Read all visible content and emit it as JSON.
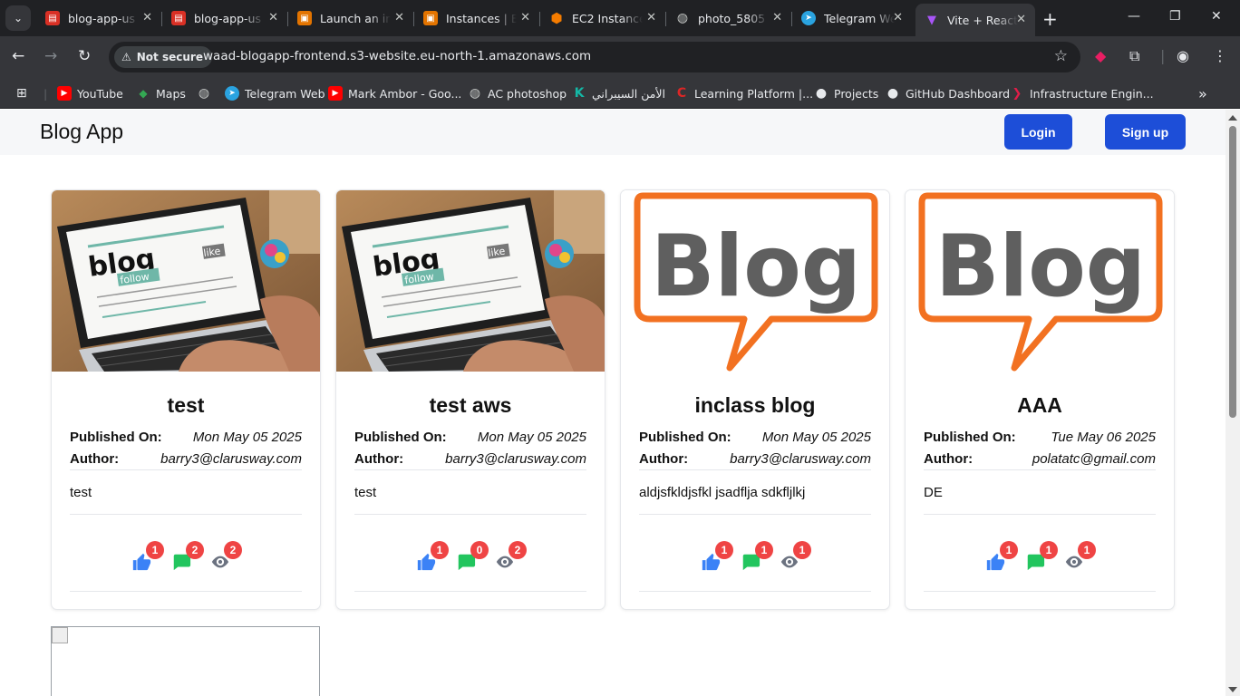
{
  "tabs": [
    {
      "title": "blog-app-us",
      "fav": "#d93025",
      "glyph": "▤"
    },
    {
      "title": "blog-app-us",
      "fav": "#d93025",
      "glyph": "▤"
    },
    {
      "title": "Launch an in",
      "fav": "#e37400",
      "glyph": "▣"
    },
    {
      "title": "Instances | E",
      "fav": "#e37400",
      "glyph": "▣"
    },
    {
      "title": "EC2 Instance",
      "fav": "#f57c00",
      "glyph": "⬢"
    },
    {
      "title": "photo_5805",
      "fav": "#5f6368",
      "glyph": "◍"
    },
    {
      "title": "Telegram We",
      "fav": "#2aa3e0",
      "glyph": "➤"
    },
    {
      "title": "Vite + React",
      "fav": "#a855f7",
      "glyph": "▼"
    }
  ],
  "address": {
    "security_label": "Not secure",
    "url": "waad-blogapp-frontend.s3-website.eu-north-1.amazonaws.com"
  },
  "bookmarks": [
    {
      "label": "YouTube",
      "color": "#ff0000",
      "glyph": "▶"
    },
    {
      "label": "Maps",
      "color": "#34a853",
      "glyph": "◆"
    },
    {
      "label": "",
      "color": "#5f6368",
      "glyph": "◍"
    },
    {
      "label": "Telegram Web",
      "color": "#2aa3e0",
      "glyph": "➤"
    },
    {
      "label": "Mark Ambor - Goo...",
      "color": "#ff0000",
      "glyph": "▶"
    },
    {
      "label": "AC photoshop",
      "color": "#5f6368",
      "glyph": "◍"
    },
    {
      "label": "الأمن السيبراني",
      "color": "#14b8a6",
      "glyph": "K"
    },
    {
      "label": "Learning Platform |...",
      "color": "#dc2626",
      "glyph": "C"
    },
    {
      "label": "Projects",
      "color": "#e8eaed",
      "glyph": "●"
    },
    {
      "label": "GitHub Dashboard",
      "color": "#e8eaed",
      "glyph": "●"
    },
    {
      "label": "Infrastructure Engin...",
      "color": "#e11d48",
      "glyph": "❯"
    }
  ],
  "app": {
    "brand": "Blog App",
    "login_label": "Login",
    "signup_label": "Sign up",
    "published_label": "Published On:",
    "author_label": "Author:"
  },
  "colors": {
    "primary": "#1d4ed8",
    "like": "#3b82f6",
    "comment": "#22c55e",
    "view": "#6b7280",
    "badge": "#ef4444"
  },
  "posts": [
    {
      "title": "test",
      "date": "Mon May 05 2025",
      "author": "barry3@clarusway.com",
      "content": "test",
      "image": "laptop",
      "likes": "1",
      "comments": "2",
      "views": "2"
    },
    {
      "title": "test aws",
      "date": "Mon May 05 2025",
      "author": "barry3@clarusway.com",
      "content": "test",
      "image": "laptop",
      "likes": "1",
      "comments": "0",
      "views": "2"
    },
    {
      "title": "inclass blog",
      "date": "Mon May 05 2025",
      "author": "barry3@clarusway.com",
      "content": "aldjsfkldjsfkl jsadflja sdkfljlkj",
      "image": "blog-logo",
      "likes": "1",
      "comments": "1",
      "views": "1"
    },
    {
      "title": "AAA",
      "date": "Tue May 06 2025",
      "author": "polatatc@gmail.com",
      "content": "DE",
      "image": "blog-logo",
      "likes": "1",
      "comments": "1",
      "views": "1"
    }
  ],
  "blog_logo_text": "Blog",
  "laptop_image_text": {
    "word": "blog",
    "follow": "follow",
    "like": "like"
  }
}
